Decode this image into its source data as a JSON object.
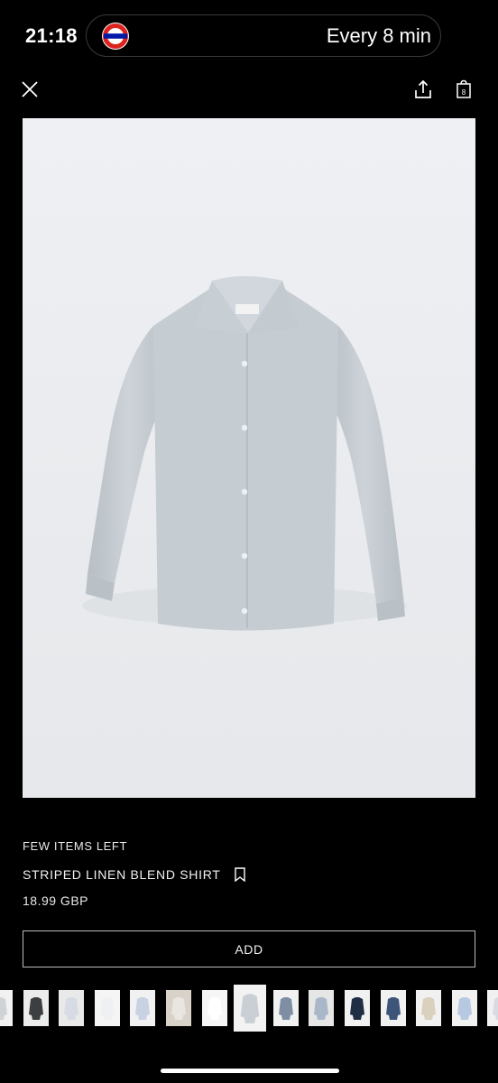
{
  "status_bar": {
    "time": "21:18",
    "live_activity": {
      "icon": "london-underground-roundel-icon",
      "text": "Every 8 min"
    }
  },
  "toolbar": {
    "close_icon": "close-icon",
    "share_icon": "share-icon",
    "bag_icon": "shopping-bag-icon",
    "bag_count": "8"
  },
  "product": {
    "stock_status": "FEW ITEMS LEFT",
    "name": "STRIPED LINEN BLEND SHIRT",
    "price": "18.99 GBP",
    "add_label": "ADD",
    "image_color": "#c9cfd4",
    "bookmark_icon": "bookmark-icon"
  },
  "thumbnails": {
    "count": 16,
    "active_index": 7,
    "items": [
      {
        "bg": "#f1f1f1",
        "fg": "#cfd3d8"
      },
      {
        "bg": "#ececec",
        "fg": "#3b3f42"
      },
      {
        "bg": "#e9e9e9",
        "fg": "#d7dbe3"
      },
      {
        "bg": "#f5f5f5",
        "fg": "#eef0f3"
      },
      {
        "bg": "#f1f1f1",
        "fg": "#c8d2e3"
      },
      {
        "bg": "#d8d2c8",
        "fg": "#e9e6e1"
      },
      {
        "bg": "#f6f6f6",
        "fg": "#ffffff"
      },
      {
        "bg": "#f3f3f3",
        "fg": "#c9cfd4"
      },
      {
        "bg": "#f1f1f1",
        "fg": "#7e8fa4"
      },
      {
        "bg": "#e6e6e6",
        "fg": "#a9b7c8"
      },
      {
        "bg": "#f1f1f1",
        "fg": "#1f2d45"
      },
      {
        "bg": "#f1f1f1",
        "fg": "#3d5579"
      },
      {
        "bg": "#f1f1f1",
        "fg": "#d9d0bd"
      },
      {
        "bg": "#f1f1f1",
        "fg": "#b7c9e0"
      },
      {
        "bg": "#f1f1f1",
        "fg": "#d8dbe1"
      }
    ]
  }
}
